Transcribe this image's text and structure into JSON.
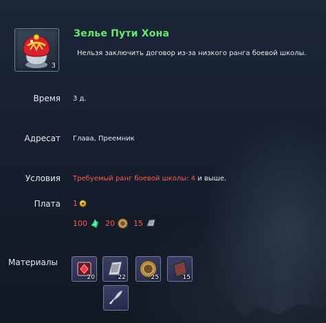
{
  "item": {
    "name": "Зелье Пути Хона",
    "count": "3",
    "description": "Нельзя заключить договор из-за низкого ранга боевой школы.",
    "icon": "potion-flask-icon"
  },
  "fields": {
    "time_label": "Время",
    "time_value": "3 д.",
    "recipient_label": "Адресат",
    "recipient_value": "Глава, Преемник",
    "conditions_label": "Условия",
    "conditions_value_red": "Требуемый ранг боевой школы: 4",
    "conditions_value_suffix": " и выше.",
    "payment_label": "Плата",
    "payment_gold": "1"
  },
  "costs": [
    {
      "amount": "100",
      "icon": "green-crystal-icon"
    },
    {
      "amount": "20",
      "icon": "bronze-medallion-icon"
    },
    {
      "amount": "15",
      "icon": "silver-ingot-icon"
    }
  ],
  "materials_label": "Материалы",
  "materials": [
    {
      "count": "20",
      "icon": "red-gem-box-icon"
    },
    {
      "count": "22",
      "icon": "silver-ingot-icon"
    },
    {
      "count": "25",
      "icon": "bronze-medallion-icon"
    },
    {
      "count": "15",
      "icon": "dark-tome-icon"
    },
    {
      "count": "",
      "icon": "feather-quill-icon"
    }
  ],
  "colors": {
    "title": "#6be86b",
    "warning": "#ff5a4a",
    "text": "#e6e8ec"
  }
}
